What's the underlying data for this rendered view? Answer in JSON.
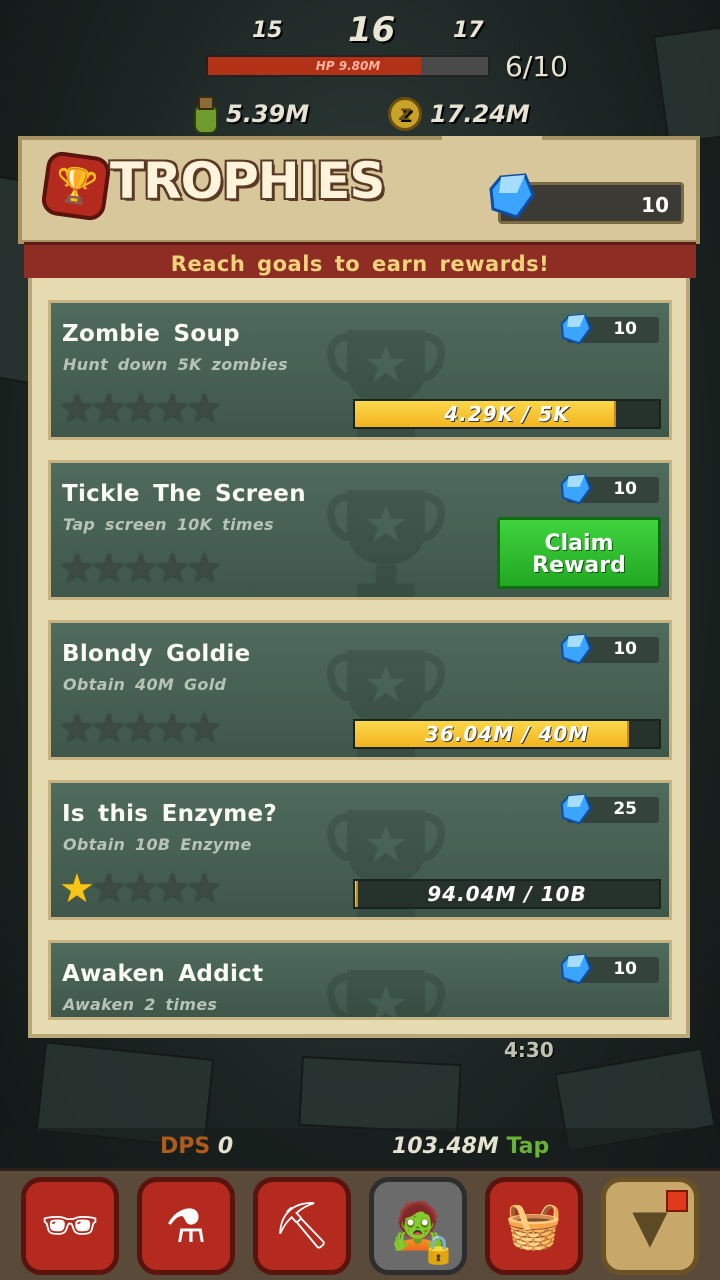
{
  "hud": {
    "level_prev": "15",
    "level_current": "16",
    "level_next": "17",
    "hp_label": "HP 9.80M",
    "hp_fraction": 0.76,
    "wave": "6/10",
    "enzyme": "5.39M",
    "gold": "17.24M"
  },
  "dialog": {
    "title": "TROPHIES",
    "gems": "10",
    "subtitle": "Reach goals to earn rewards!"
  },
  "trophies": [
    {
      "title": "Zombie Soup",
      "desc": "Hunt down 5K zombies",
      "reward": "10",
      "stars": 0,
      "progress_text": "4.29K / 5K",
      "progress": 0.858
    },
    {
      "title": "Tickle The Screen",
      "desc": "Tap screen 10K times",
      "reward": "10",
      "stars": 0,
      "claim_label": "Claim Reward"
    },
    {
      "title": "Blondy Goldie",
      "desc": "Obtain 40M Gold",
      "reward": "10",
      "stars": 0,
      "progress_text": "36.04M / 40M",
      "progress": 0.901
    },
    {
      "title": "Is this Enzyme?",
      "desc": "Obtain 10B Enzyme",
      "reward": "25",
      "stars": 1,
      "progress_text": "94.04M / 10B",
      "progress": 0.009
    },
    {
      "title": "Awaken Addict",
      "desc": "Awaken 2 times",
      "reward": "10",
      "stars": 0
    }
  ],
  "footer": {
    "timer": "4:30",
    "dps_label": "DPS",
    "dps_value": "0",
    "tap_value": "103.48M",
    "tap_label": "Tap"
  },
  "colors": {
    "accent_red": "#b42a1f",
    "claim_green": "#2fbf2f",
    "progress_yellow": "#f2b41f",
    "card_green": "#4f6b5d"
  },
  "icons": [
    "trophy-icon",
    "gem-icon",
    "enzyme-bottle-icon",
    "gold-coin-icon",
    "hero-icon",
    "potion-icon",
    "pickaxe-icon",
    "locked-ally-icon",
    "shop-icon",
    "menu-down-icon"
  ]
}
